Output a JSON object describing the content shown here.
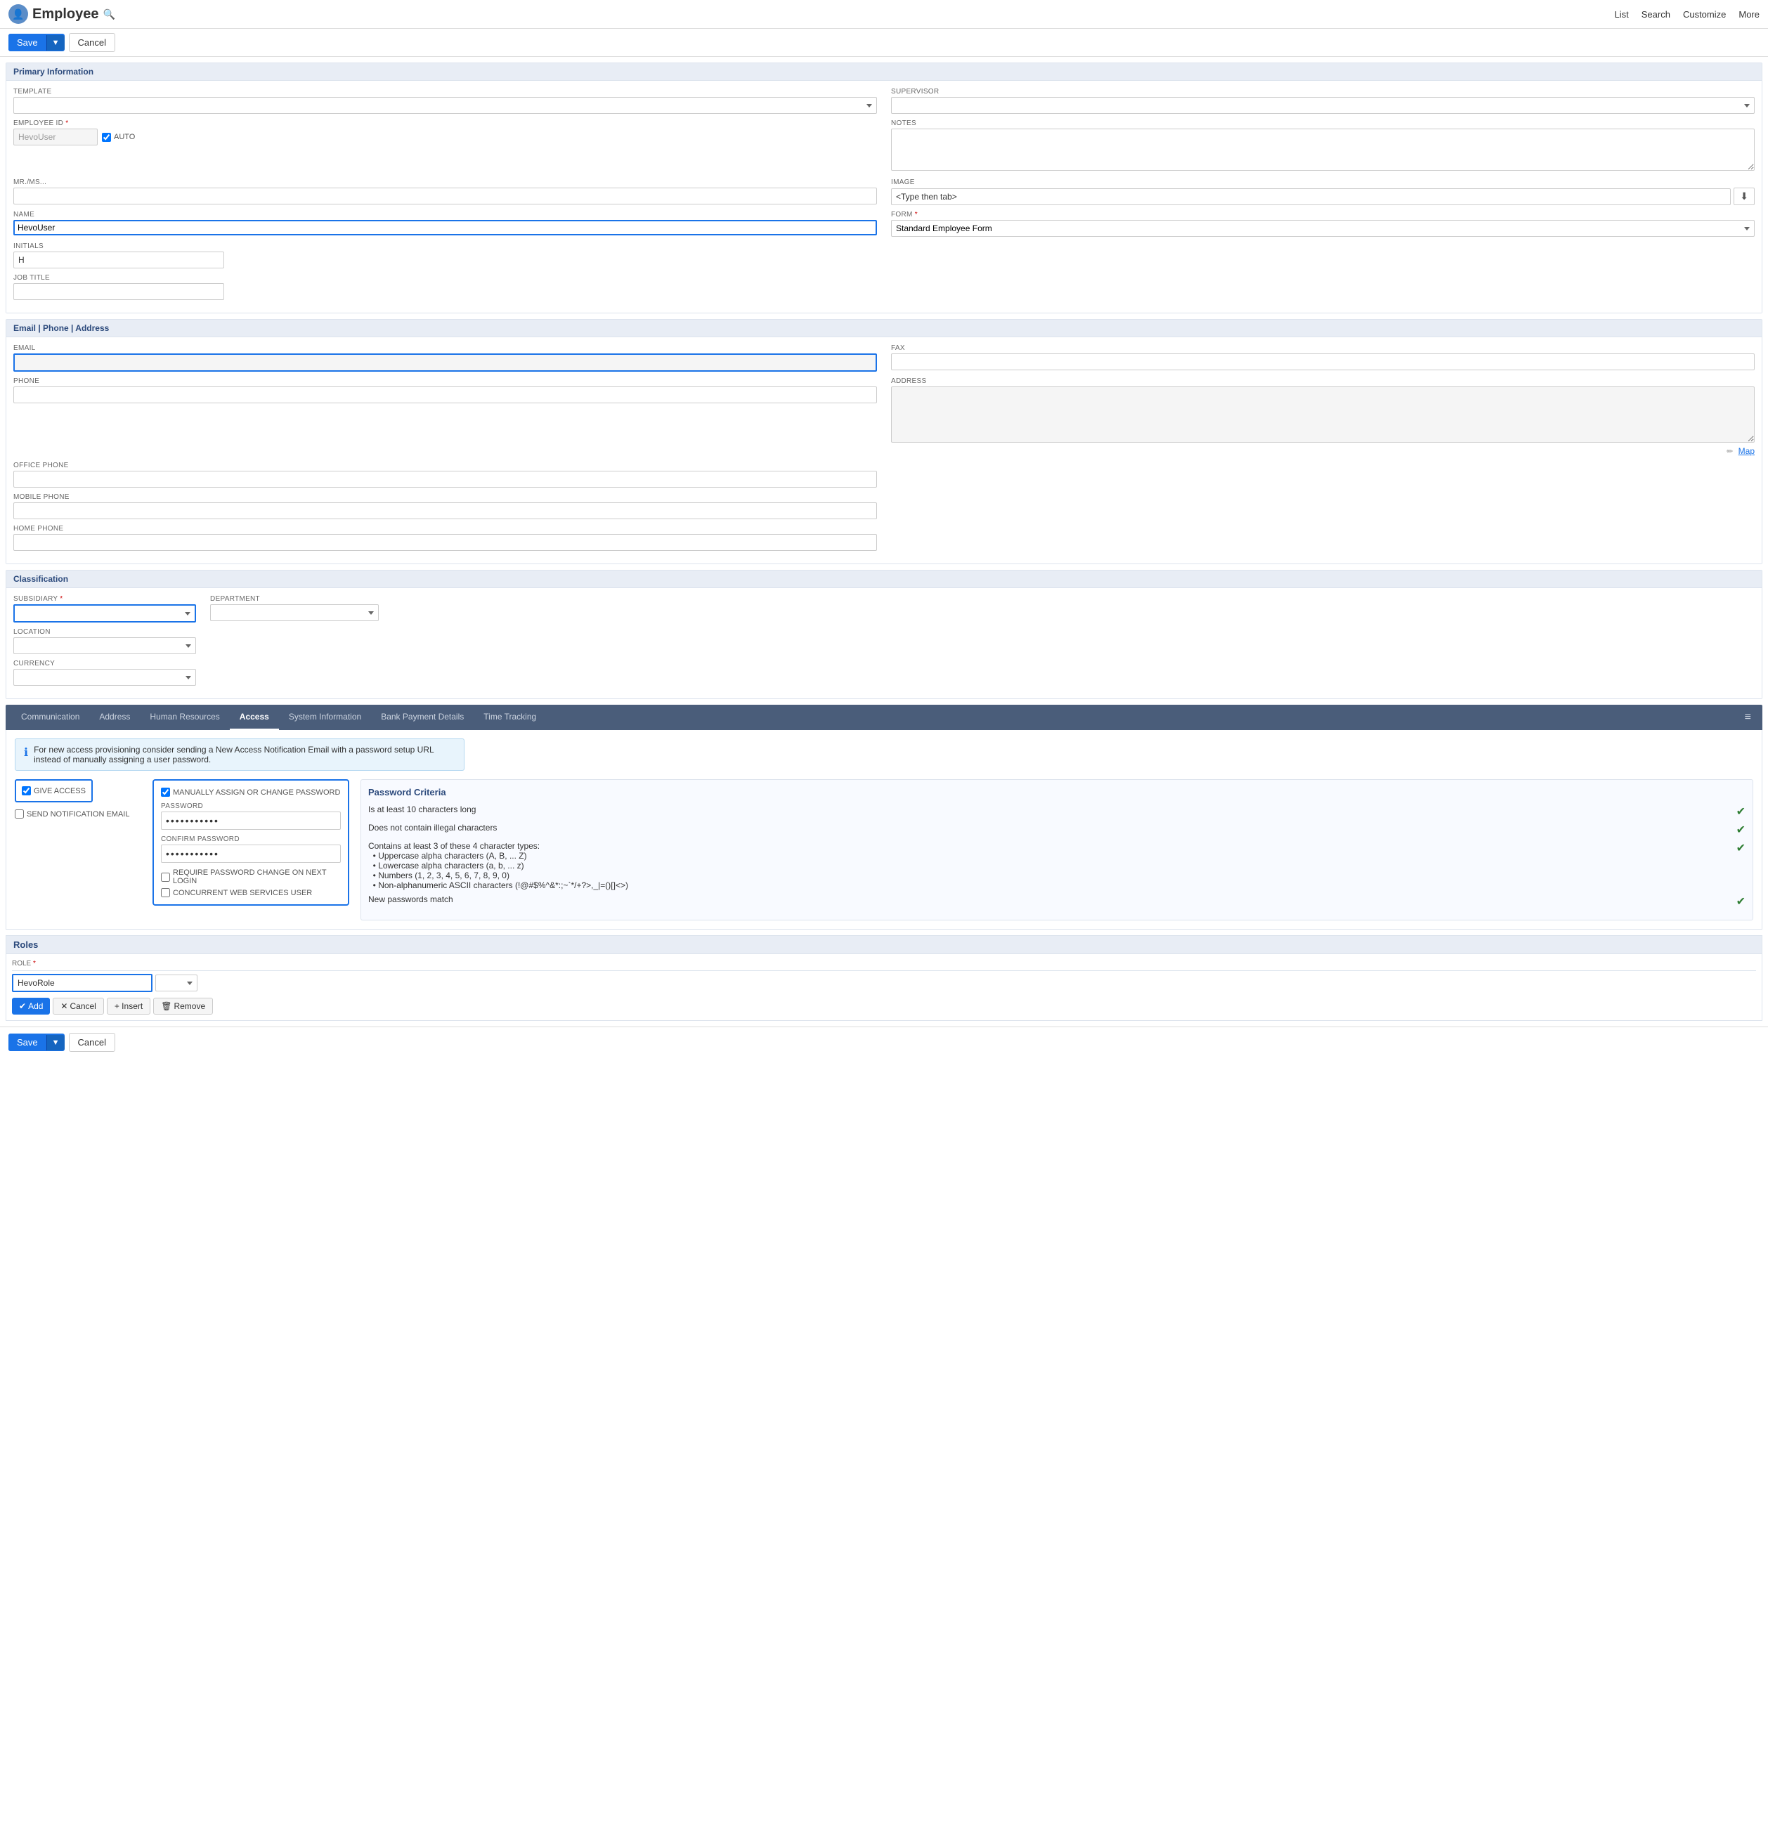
{
  "header": {
    "title": "Employee",
    "search_tooltip": "Search",
    "nav": [
      "List",
      "Search",
      "Customize",
      "More"
    ]
  },
  "toolbar": {
    "save_label": "Save",
    "cancel_label": "Cancel",
    "dropdown_arrow": "▼"
  },
  "sections": {
    "primary": {
      "title": "Primary Information",
      "fields": {
        "template_label": "TEMPLATE",
        "supervisor_label": "SUPERVISOR",
        "employee_id_label": "EMPLOYEE ID",
        "employee_id_value": "HevoUser",
        "auto_label": "AUTO",
        "notes_label": "NOTES",
        "mr_ms_label": "MR./MS...",
        "image_label": "IMAGE",
        "image_value": "<Type then tab>",
        "name_label": "NAME",
        "name_value": "HevoUser",
        "form_label": "FORM",
        "form_value": "",
        "initials_label": "INITIALS",
        "initials_value": "H",
        "job_title_label": "JOB TITLE"
      }
    },
    "email_phone": {
      "title": "Email | Phone | Address",
      "fields": {
        "email_label": "EMAIL",
        "email_placeholder": "",
        "fax_label": "FAX",
        "phone_label": "PHONE",
        "address_label": "ADDRESS",
        "office_phone_label": "OFFICE PHONE",
        "mobile_phone_label": "MOBILE PHONE",
        "home_phone_label": "HOME PHONE",
        "map_link": "Map"
      }
    },
    "classification": {
      "title": "Classification",
      "fields": {
        "subsidiary_label": "SUBSIDIARY",
        "department_label": "DEPARTMENT",
        "location_label": "LOCATION",
        "currency_label": "CURRENCY"
      }
    }
  },
  "tabs": {
    "items": [
      {
        "id": "communication",
        "label": "Communication",
        "active": false
      },
      {
        "id": "address",
        "label": "Address",
        "active": false
      },
      {
        "id": "human-resources",
        "label": "Human Resources",
        "active": false
      },
      {
        "id": "access",
        "label": "Access",
        "active": true
      },
      {
        "id": "system-information",
        "label": "System Information",
        "active": false
      },
      {
        "id": "bank-payment",
        "label": "Bank Payment Details",
        "active": false
      },
      {
        "id": "time-tracking",
        "label": "Time Tracking",
        "active": false
      }
    ]
  },
  "access_tab": {
    "info_banner": "For new access provisioning consider sending a New Access Notification Email with a password setup URL instead of manually assigning a user password.",
    "give_access_label": "GIVE ACCESS",
    "give_access_checked": true,
    "send_notification_label": "SEND NOTIFICATION EMAIL",
    "manually_assign_label": "MANUALLY ASSIGN OR CHANGE PASSWORD",
    "manually_assign_checked": true,
    "password_label": "PASSWORD",
    "password_value": "••••••••••••",
    "confirm_password_label": "CONFIRM PASSWORD",
    "confirm_password_value": "••••••••••••",
    "require_password_label": "REQUIRE PASSWORD CHANGE ON NEXT LOGIN",
    "concurrent_user_label": "CONCURRENT WEB SERVICES USER",
    "pw_criteria": {
      "title": "Password Criteria",
      "items": [
        {
          "text": "Is at least 10 characters long",
          "pass": true
        },
        {
          "text": "Does not contain illegal characters",
          "pass": true
        },
        {
          "text": "Contains at least 3 of these 4 character types:\n• Uppercase alpha characters (A, B, ... Z)\n• Lowercase alpha characters (a, b, ... z)\n• Numbers (1, 2, 3, 4, 5, 6, 7, 8, 9, 0)\n• Non-alphanumeric ASCII characters (!@#$%^&*:;~`*/+?>,_|=()[]<>)",
          "pass": true
        },
        {
          "text": "New passwords match",
          "pass": true
        }
      ]
    }
  },
  "roles": {
    "title": "Roles",
    "role_label": "ROLE",
    "role_value": "HevoRole",
    "buttons": {
      "add": "Add",
      "cancel": "Cancel",
      "insert": "+ Insert",
      "remove": "🗑 Remove"
    }
  },
  "bottom_toolbar": {
    "save_label": "Save",
    "cancel_label": "Cancel",
    "dropdown_arrow": "▼"
  }
}
